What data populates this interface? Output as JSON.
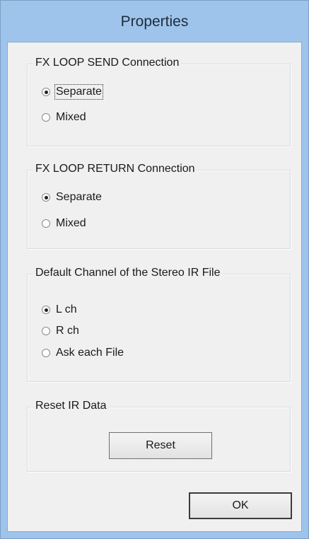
{
  "window": {
    "title": "Properties"
  },
  "fx_send": {
    "caption": "FX LOOP SEND Connection",
    "options": [
      {
        "label": "Separate",
        "checked": true
      },
      {
        "label": "Mixed",
        "checked": false
      }
    ]
  },
  "fx_return": {
    "caption": "FX LOOP RETURN Connection",
    "options": [
      {
        "label": "Separate",
        "checked": true
      },
      {
        "label": "Mixed",
        "checked": false
      }
    ]
  },
  "default_channel": {
    "caption": "Default Channel of the Stereo IR File",
    "options": [
      {
        "label": "L ch",
        "checked": true
      },
      {
        "label": "R ch",
        "checked": false
      },
      {
        "label": "Ask each File",
        "checked": false
      }
    ]
  },
  "reset_ir": {
    "caption": "Reset IR Data",
    "button_label": "Reset"
  },
  "ok_button_label": "OK"
}
